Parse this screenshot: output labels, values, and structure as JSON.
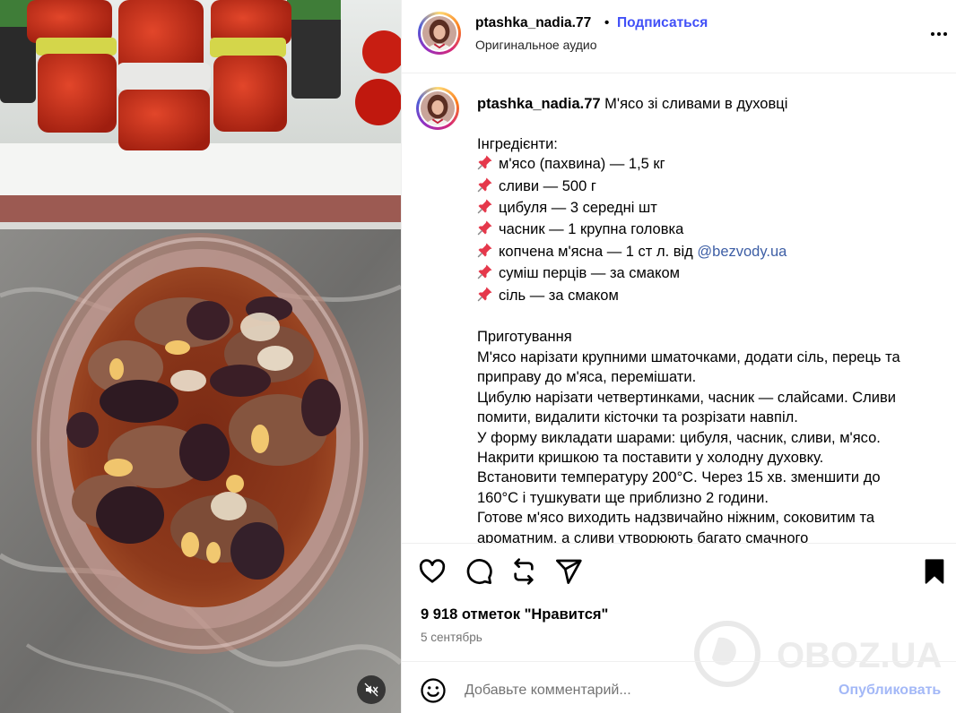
{
  "header": {
    "username": "ptashka_nadia.77",
    "dot": "•",
    "follow_label": "Подписаться",
    "audio_label": "Оригинальное аудио"
  },
  "caption": {
    "username": "ptashka_nadia.77",
    "title": "М'ясо зі сливами в духовці",
    "ingredients_heading": "Інгредієнти:",
    "ingredients": [
      "м'ясо (пахвина) — 1,5 кг",
      "сливи — 500 г",
      "цибуля — 3 середні шт",
      "часник — 1 крупна головка",
      "копчена м'ясна — 1 ст л. від ",
      "суміш перців — за смаком",
      "сіль — за смаком"
    ],
    "mention": "@bezvody.ua",
    "preparation_heading": "Приготування",
    "preparation": [
      "М'ясо нарізати крупними шматочками, додати сіль, перець та",
      "приправу до м'яса, перемішати.",
      "Цибулю нарізати четвертинками, часник — слайсами. Сливи",
      "помити, видалити кісточки та розрізати навпіл.",
      "У форму викладати шарами: цибуля, часник, сливи, м'ясо.",
      "Накрити кришкою та поставити у холодну духовку.",
      "Встановити температуру 200°С. Через 15 хв. зменшити до",
      "160°С і тушкувати ще приблизно 2 години.",
      "Готове м'ясо виходить надзвичайно ніжним, соковитим та",
      "ароматним, а сливи утворюють багато смачного"
    ]
  },
  "stats": {
    "likes": "9 918 отметок \"Нравится\"",
    "date": "5 сентябрь"
  },
  "comment": {
    "placeholder": "Добавьте комментарий...",
    "publish_label": "Опубликовать"
  },
  "watermark": {
    "text": "OBOZ.UA"
  },
  "icons": {
    "like": "heart-icon",
    "comment": "comment-icon",
    "share": "repost-icon",
    "send": "send-icon",
    "save": "bookmark-icon",
    "more": "more-icon",
    "mute": "mute-icon",
    "emoji": "emoji-icon",
    "pin": "pushpin-icon"
  },
  "colors": {
    "follow": "#4150f7",
    "mention": "#3d5ea5",
    "publish_disabled": "#a3b8f7",
    "secondary_text": "#737373",
    "pin": "#e5384b"
  }
}
